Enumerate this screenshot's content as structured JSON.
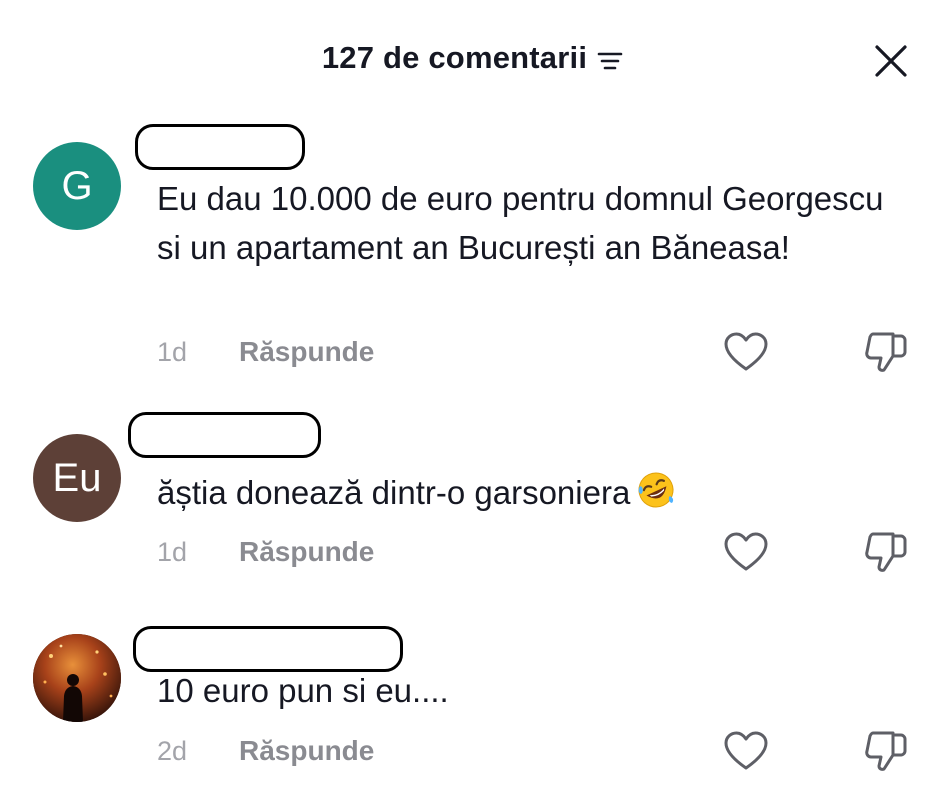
{
  "header": {
    "title": "127 de comentarii",
    "sort_icon": "sort-lines-icon",
    "close_icon": "close-icon"
  },
  "comments": [
    {
      "avatar_letter": "G",
      "avatar_color": "#1a8f7f",
      "text": "Eu dau 10.000 de euro pentru domnul Georgescu si un apartament an București an Băneasa!",
      "time": "1d",
      "reply_label": "Răspunde"
    },
    {
      "avatar_letter": "Eu",
      "avatar_color": "#5d4037",
      "text": "ăștia donează dintr-o garsoniera",
      "emoji": "rolling-on-floor-laughing-emoji",
      "time": "1d",
      "reply_label": "Răspunde"
    },
    {
      "avatar_photo": "person-silhouette-photo",
      "text": "10 euro pun si eu....",
      "time": "2d",
      "reply_label": "Răspunde"
    }
  ],
  "colors": {
    "text_primary": "#161823",
    "text_secondary": "#8a8b91",
    "time_text": "#a3a4aa",
    "icon_stroke": "#5e5f66"
  }
}
